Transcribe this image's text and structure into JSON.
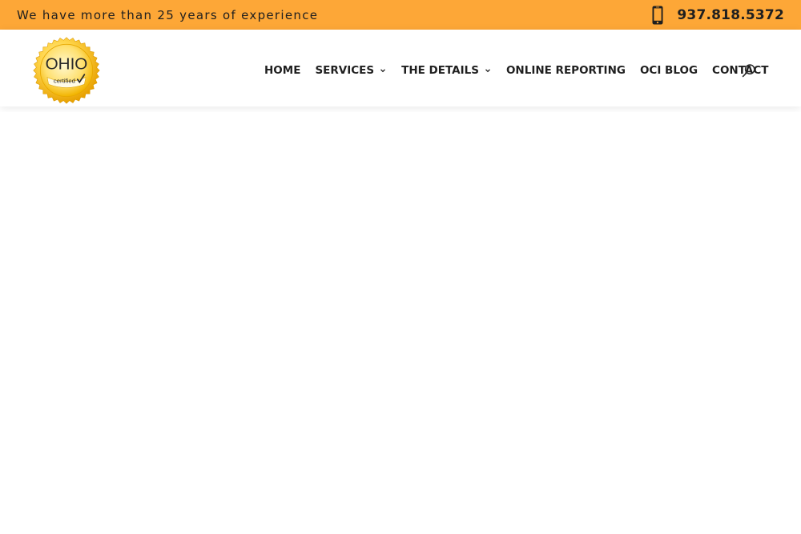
{
  "top_bar": {
    "tagline": "We have more than 25 years of experience",
    "phone_number": "937.818.5372",
    "background_color": "#fda737",
    "phone_icon": "smartphone-icon"
  },
  "logo": {
    "main_text": "OHIO",
    "sub_text": "certified",
    "badge_colors": [
      "#f7b500",
      "#ffd54a",
      "#fff3b0"
    ]
  },
  "nav": {
    "items": [
      {
        "label": "HOME",
        "has_dropdown": false
      },
      {
        "label": "SERVICES",
        "has_dropdown": true
      },
      {
        "label": "THE DETAILS",
        "has_dropdown": true
      },
      {
        "label": "ONLINE REPORTING",
        "has_dropdown": false
      },
      {
        "label": "OCI BLOG",
        "has_dropdown": false
      },
      {
        "label": "CONTACT",
        "has_dropdown": false
      }
    ],
    "search_icon": "search-icon"
  }
}
